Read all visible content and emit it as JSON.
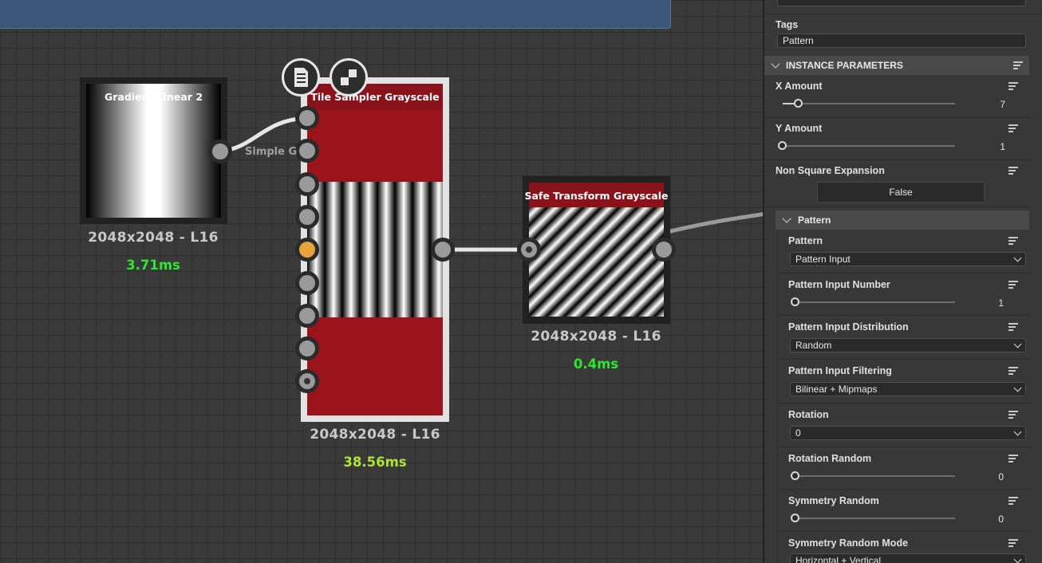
{
  "graph": {
    "nodes": {
      "gradient": {
        "title": "Gradient Linear 2",
        "resolution": "2048x2048 - L16",
        "time": "3.71ms",
        "time_color": "#2ee62e"
      },
      "tile_sampler": {
        "title": "Tile Sampler Grayscale",
        "resolution": "2048x2048 - L16",
        "time": "38.56ms",
        "time_color": "#aee62e",
        "active_input_index": 4
      },
      "safe_transform": {
        "title": "Safe Transform Grayscale",
        "resolution": "2048x2048 - L16",
        "time": "0.4ms",
        "time_color": "#2ee62e"
      }
    },
    "wire_label": "Simple G",
    "floating_buttons": [
      "document-icon",
      "checker-icon"
    ]
  },
  "panel": {
    "tags_label": "Tags",
    "tags_value": "Pattern",
    "instance_section": "INSTANCE PARAMETERS",
    "params": {
      "x_amount": {
        "label": "X Amount",
        "value": "7",
        "fraction": 0.03
      },
      "y_amount": {
        "label": "Y Amount",
        "value": "1",
        "fraction": 0.0
      },
      "non_square": {
        "label": "Non Square Expansion",
        "value": "False"
      }
    },
    "pattern_section": "Pattern",
    "pattern": {
      "pattern": {
        "label": "Pattern",
        "value": "Pattern Input"
      },
      "input_number": {
        "label": "Pattern Input Number",
        "value": "1",
        "fraction": 0.0
      },
      "distribution": {
        "label": "Pattern Input Distribution",
        "value": "Random"
      },
      "filtering": {
        "label": "Pattern Input Filtering",
        "value": "Bilinear + Mipmaps"
      },
      "rotation": {
        "label": "Rotation",
        "value": "0"
      },
      "rotation_random": {
        "label": "Rotation Random",
        "value": "0",
        "fraction": 0.0
      },
      "symmetry_random": {
        "label": "Symmetry Random",
        "value": "0",
        "fraction": 0.0
      },
      "symmetry_mode": {
        "label": "Symmetry Random Mode",
        "value": "Horizontal + Vertical"
      }
    }
  }
}
